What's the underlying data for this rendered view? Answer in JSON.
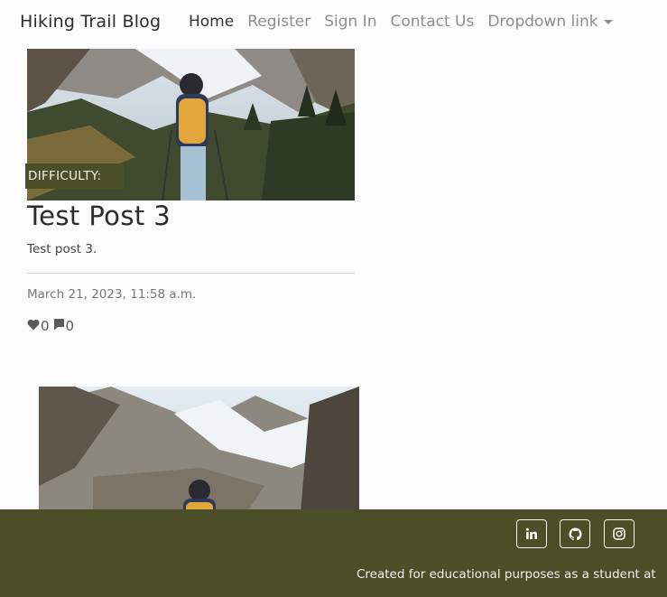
{
  "nav": {
    "brand": "Hiking Trail Blog",
    "links": [
      {
        "label": "Home",
        "active": true
      },
      {
        "label": "Register"
      },
      {
        "label": "Sign In"
      },
      {
        "label": "Contact Us"
      },
      {
        "label": "Dropdown link"
      }
    ]
  },
  "posts": [
    {
      "difficulty_label": "DIFFICULTY:",
      "title": "Test Post 3",
      "excerpt": "Test post 3.",
      "date": "March 21, 2023, 11:58 a.m.",
      "likes": "0",
      "comments": "0",
      "image": "hiker-mountain-photo"
    },
    {
      "image": "hiker-mountain-photo"
    }
  ],
  "footer": {
    "social": [
      {
        "icon": "linkedin-icon"
      },
      {
        "icon": "github-icon"
      },
      {
        "icon": "instagram-icon"
      }
    ],
    "text": "Created for educational purposes as a student at"
  },
  "colors": {
    "accent": "#4b4f27",
    "background": "#fcfcfc"
  }
}
